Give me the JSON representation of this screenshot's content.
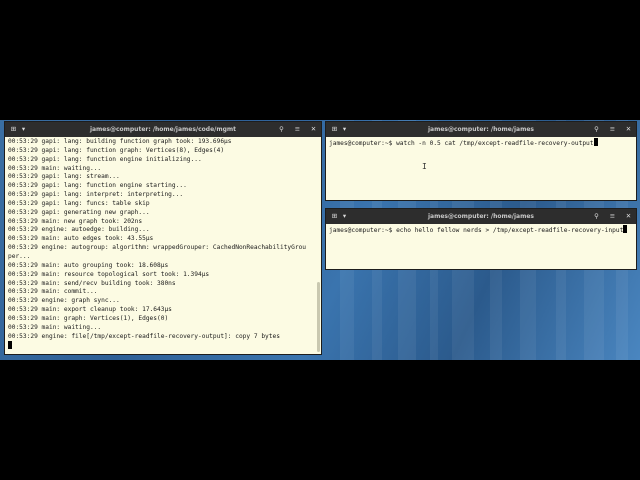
{
  "left_terminal": {
    "title": "james@computer: /home/james/code/mgmt",
    "lines": [
      "00:53:29 gapi: lang: building function graph took: 193.696µs",
      "00:53:29 gapi: lang: function graph: Vertices(8), Edges(4)",
      "00:53:29 gapi: lang: function engine initializing...",
      "00:53:29 main: waiting...",
      "00:53:29 gapi: lang: stream...",
      "00:53:29 gapi: lang: function engine starting...",
      "00:53:29 gapi: lang: interpret: interpreting...",
      "00:53:29 gapi: lang: funcs: table skip",
      "00:53:29 gapi: generating new graph...",
      "00:53:29 main: new graph took: 202ns",
      "00:53:29 engine: autoedge: building...",
      "00:53:29 main: auto edges took: 43.55µs",
      "00:53:29 engine: autogroup: algorithm: wrappedGrouper: CachedNonReachabilityGrou",
      "per...",
      "00:53:29 main: auto grouping took: 18.608µs",
      "00:53:29 main: resource topological sort took: 1.394µs",
      "00:53:29 main: send/recv building took: 380ns",
      "00:53:29 main: commit...",
      "00:53:29 engine: graph sync...",
      "00:53:29 main: export cleanup took: 17.643µs",
      "00:53:29 main: graph: Vertices(1), Edges(0)",
      "00:53:29 main: waiting...",
      "00:53:29 engine: file[/tmp/except-readfile-recovery-output]: copy 7 bytes"
    ]
  },
  "top_right_terminal": {
    "title": "james@computer: /home/james",
    "prompt": "james@computer:~$ ",
    "command": "watch -n 0.5 cat /tmp/except-readfile-recovery-output"
  },
  "bottom_right_terminal": {
    "title": "james@computer: /home/james",
    "prompt": "james@computer:~$ ",
    "command": "echo hello fellow nerds > /tmp/except-readfile-recovery-input"
  },
  "icons": {
    "new_tab": "new-tab-icon",
    "dropdown": "chevron-down-icon",
    "search": "search-icon",
    "menu": "hamburger-menu-icon",
    "close": "close-icon"
  }
}
